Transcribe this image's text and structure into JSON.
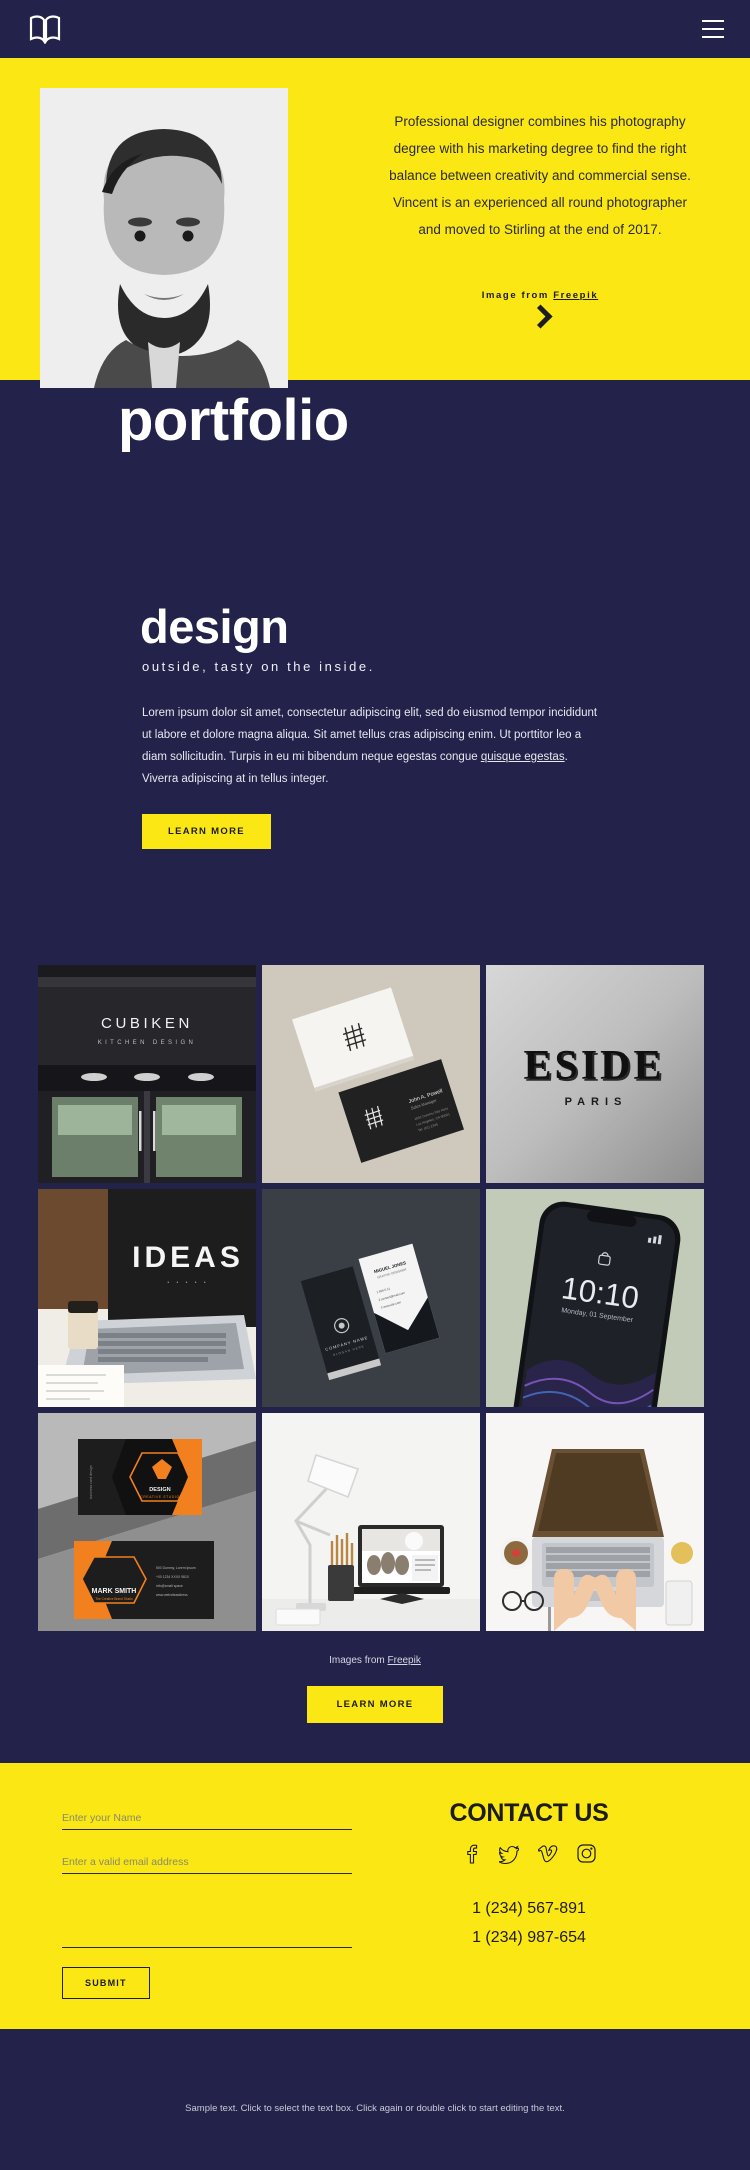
{
  "header": {
    "logo_icon": "open-book-icon",
    "menu_icon": "hamburger-menu-icon"
  },
  "hero": {
    "paragraph": "Professional designer combines his photography degree with his marketing degree to find the right balance between creativity and commercial sense. Vincent is an experienced all round photographer and moved to Stirling at the end of 2017.",
    "credit_prefix": "Image from ",
    "credit_link": "Freepik",
    "next_icon": "chevron-right-icon",
    "title": "portfolio",
    "photo_alt": "portrait-photo-black-and-white"
  },
  "design": {
    "title": "design",
    "subtitle": "outside, tasty on the inside.",
    "body_part1": "Lorem ipsum dolor sit amet, consectetur adipiscing elit, sed do eiusmod tempor incididunt ut labore et dolore magna aliqua. Sit amet tellus cras adipiscing enim. Ut porttitor leo a diam sollicitudin. Turpis in eu mi bibendum neque egestas congue ",
    "body_link": "quisque egestas",
    "body_part2": ". Viverra adipiscing at in tellus integer.",
    "learn_more": "LEARN MORE"
  },
  "gallery": {
    "tiles": [
      {
        "name": "cubiken-storefront",
        "line1": "CUBIKEN",
        "line2": "KITCHEN DESIGN"
      },
      {
        "name": "white-black-business-cards",
        "line1": "",
        "line2": "John A. Powell"
      },
      {
        "name": "eside-paris-embossed-logo",
        "line1": "ESIDE",
        "line2": "PARIS"
      },
      {
        "name": "laptop-ideas-screen",
        "line1": "IDEAS",
        "line2": ""
      },
      {
        "name": "stacked-business-cards-dark",
        "line1": "MIGUEL JONES",
        "line2": ""
      },
      {
        "name": "smartphone-lockscreen",
        "line1": "10:10",
        "line2": "Monday, 01 September"
      },
      {
        "name": "orange-black-business-cards",
        "line1": "DESIGN",
        "line2": "MARK SMITH"
      },
      {
        "name": "desk-lamp-laptop-mockup",
        "line1": "",
        "line2": ""
      },
      {
        "name": "hands-typing-on-laptop-overhead",
        "line1": "",
        "line2": ""
      }
    ],
    "credit_prefix": "Images from ",
    "credit_link": "Freepik",
    "learn_more": "LEARN MORE"
  },
  "contact": {
    "name_placeholder": "Enter your Name",
    "email_placeholder": "Enter a valid email address",
    "message_placeholder": "",
    "submit_label": "SUBMIT",
    "heading": "CONTACT US",
    "socials": [
      {
        "name": "facebook-icon"
      },
      {
        "name": "twitter-icon"
      },
      {
        "name": "vimeo-icon"
      },
      {
        "name": "instagram-icon"
      }
    ],
    "phone1": "1 (234) 567-891",
    "phone2": "1 (234) 987-654"
  },
  "footer": {
    "text": "Sample text. Click to select the text box. Click again or double click to start editing the text."
  },
  "colors": {
    "yellow": "#fbe714",
    "navy": "#22224a",
    "white": "#ffffff"
  }
}
